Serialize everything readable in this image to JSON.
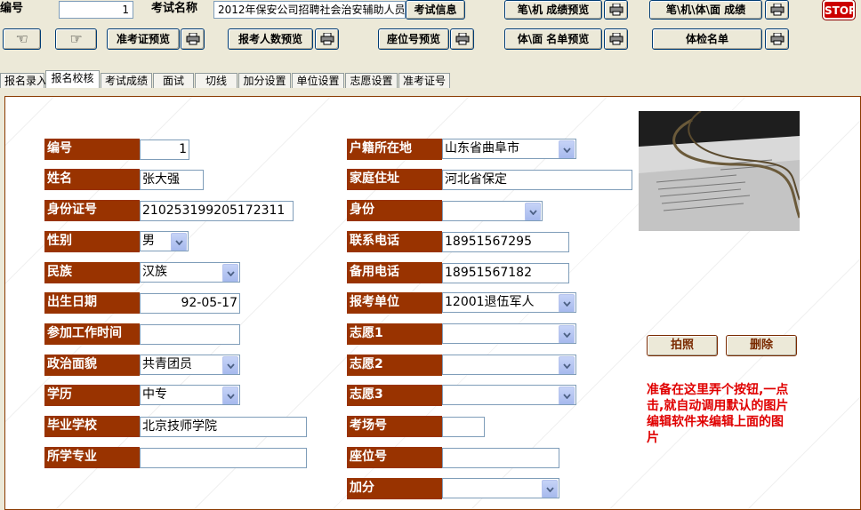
{
  "toolbar": {
    "id_label": "编号",
    "id_value": "1",
    "exam_name_label": "考试名称",
    "exam_name_value": "2012年保安公司招聘社会治安辅助人员",
    "exam_info_btn": "考试信息",
    "written_score_preview_btn": "笔\\机  成绩预览",
    "written_interview_score_btn": "笔\\机\\体\\面  成绩",
    "stop_btn": "STOP",
    "admission_preview_btn": "准考证预览",
    "applicant_count_preview_btn": "报考人数预览",
    "seat_preview_btn": "座位号预览",
    "physical_list_preview_btn": "体\\面  名单预览",
    "physical_list_btn": "体检名单"
  },
  "tabs": [
    {
      "label": "报名录入",
      "active": false
    },
    {
      "label": "报名校核",
      "active": true
    },
    {
      "label": "考试成绩",
      "active": false
    },
    {
      "label": "面试",
      "active": false
    },
    {
      "label": "切线",
      "active": false
    },
    {
      "label": "加分设置",
      "active": false
    },
    {
      "label": "单位设置",
      "active": false
    },
    {
      "label": "志愿设置",
      "active": false
    },
    {
      "label": "准考证号",
      "active": false
    }
  ],
  "form": {
    "left": [
      {
        "label": "编号",
        "value": "1"
      },
      {
        "label": "姓名",
        "value": "张大强"
      },
      {
        "label": "身份证号",
        "value": "210253199205172311"
      },
      {
        "label": "性别",
        "value": "男"
      },
      {
        "label": "民族",
        "value": "汉族"
      },
      {
        "label": "出生日期",
        "value": "92-05-17"
      },
      {
        "label": "参加工作时间",
        "value": ""
      },
      {
        "label": "政治面貌",
        "value": "共青团员"
      },
      {
        "label": "学历",
        "value": "中专"
      },
      {
        "label": "毕业学校",
        "value": "北京技师学院"
      },
      {
        "label": "所学专业",
        "value": ""
      }
    ],
    "right": [
      {
        "label": "户籍所在地",
        "value": "山东省曲阜市"
      },
      {
        "label": "家庭住址",
        "value": "河北省保定"
      },
      {
        "label": "身份",
        "value": ""
      },
      {
        "label": "联系电话",
        "value": "18951567295"
      },
      {
        "label": "备用电话",
        "value": "18951567182"
      },
      {
        "label": "报考单位",
        "value": "12001退伍军人"
      },
      {
        "label": "志愿1",
        "value": ""
      },
      {
        "label": "志愿2",
        "value": ""
      },
      {
        "label": "志愿3",
        "value": ""
      },
      {
        "label": "考场号",
        "value": ""
      },
      {
        "label": "座位号",
        "value": ""
      },
      {
        "label": "加分",
        "value": ""
      }
    ]
  },
  "photo_actions": {
    "take_photo": "拍照",
    "delete": "删除"
  },
  "note": "准备在这里弄个按钮,一点击,就自动调用默认的图片编辑软件来编辑上面的图片",
  "colors": {
    "label_bg": "#993300",
    "note": "#e00000",
    "window_bg": "#ece9d8"
  }
}
